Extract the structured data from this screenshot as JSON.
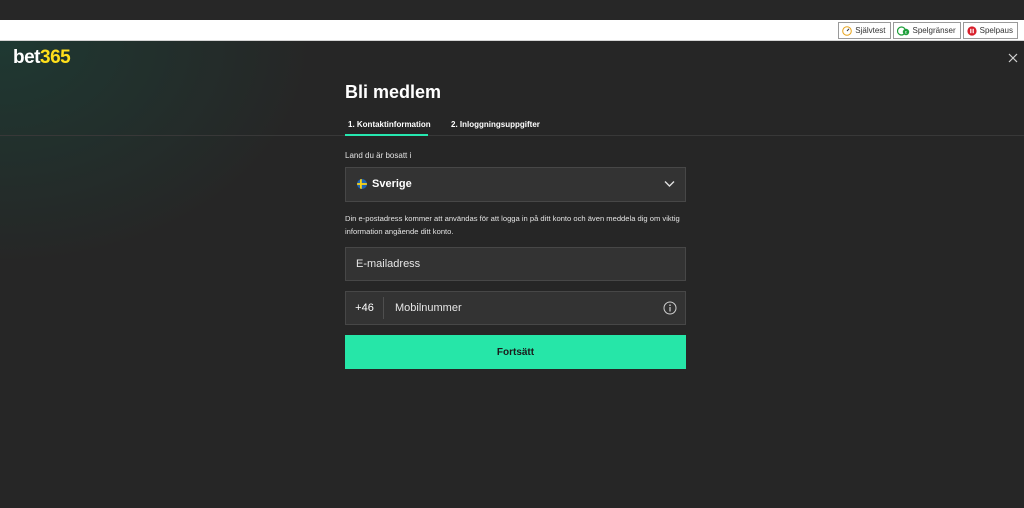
{
  "responsible_gaming": {
    "links": [
      {
        "label": "Självtest",
        "icon": "gauge-icon",
        "color": "#e7a31a"
      },
      {
        "label": "Spelgränser",
        "icon": "limits-icon",
        "color": "#1e9f3a"
      },
      {
        "label": "Spelpaus",
        "icon": "pause-icon",
        "color": "#d81e2a"
      }
    ]
  },
  "brand": {
    "name_prefix": "bet",
    "name_number": "365",
    "accent_color": "#ffdf1b"
  },
  "close_icon": "close-icon",
  "form": {
    "title": "Bli medlem",
    "steps": [
      {
        "label": "1.  Kontaktinformation",
        "active": true
      },
      {
        "label": "2.  Inloggningsuppgifter",
        "active": false
      }
    ],
    "country_label": "Land du är bosatt i",
    "country_value": "Sverige",
    "country_flag_icon": "sweden-flag-icon",
    "email_info": "Din e-postadress kommer att användas för att logga in på ditt konto och även meddela dig om viktig information angående ditt konto.",
    "email_placeholder": "E-mailadress",
    "phone_prefix": "+46",
    "phone_placeholder": "Mobilnummer",
    "continue_label": "Fortsätt",
    "continue_color": "#26e6a8"
  }
}
